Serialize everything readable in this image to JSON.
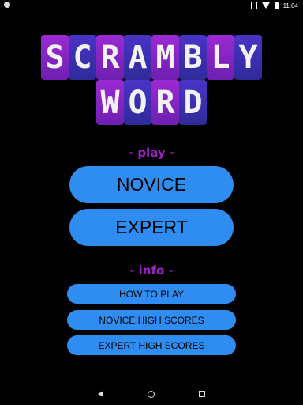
{
  "status_bar": {
    "time": "11:04"
  },
  "title": {
    "row1": [
      "S",
      "C",
      "R",
      "A",
      "M",
      "B",
      "L",
      "Y"
    ],
    "row2": [
      "W",
      "O",
      "R",
      "D"
    ]
  },
  "sections": {
    "play_label": "- play -",
    "info_label": "- info -"
  },
  "buttons": {
    "novice": "NOVICE",
    "expert": "EXPERT",
    "how_to_play": "HOW TO PLAY",
    "novice_high_scores": "NOVICE HIGH SCORES",
    "expert_high_scores": "EXPERT HIGH SCORES"
  },
  "colors": {
    "background": "#000000",
    "button": "#2f8cf0",
    "section_label": "#a020c8",
    "tile_purple": "#8a25c8",
    "tile_blue": "#3b2fb5"
  }
}
